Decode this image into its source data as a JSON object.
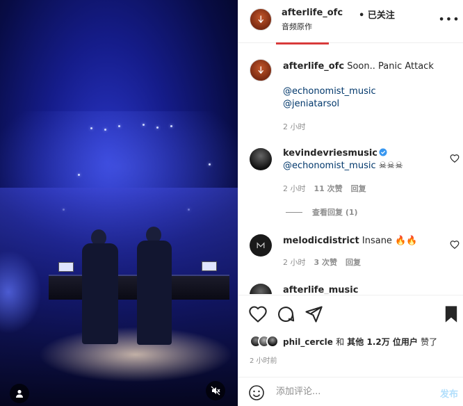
{
  "header": {
    "username": "afterlife_ofc",
    "follow_status": "• 已关注",
    "subtitle": "音频原作",
    "more_icon": "more-horizontal-icon"
  },
  "comments": [
    {
      "user": "afterlife_ofc",
      "text": "Soon.. Panic Attack",
      "mentions": [
        "@echonomist_music",
        "@jeniatarsol"
      ],
      "time": "2 小时"
    },
    {
      "user": "kevindevriesmusic",
      "verified": true,
      "mention": "@echonomist_music",
      "emoji": "☠☠☠",
      "time": "2 小时",
      "likes": "11 次赞",
      "reply": "回复"
    },
    {
      "view_replies": "查看回复 (1)"
    },
    {
      "user": "melodicdistrict",
      "text": "Insane",
      "emoji": "🔥🔥",
      "time": "2 小时",
      "likes": "3 次赞",
      "reply": "回复"
    },
    {
      "user": "afterlife_music",
      "text": "",
      "partial": true
    }
  ],
  "likes": {
    "user": "phil_cercle",
    "and": "和",
    "others": "其他 1.2万 位用户",
    "suffix": "赞了"
  },
  "time_ago": "2 小时前",
  "comment_box": {
    "placeholder": "添加评论...",
    "post": "发布"
  },
  "colors": {
    "accent": "#d83a3a",
    "link": "#00376b",
    "muted": "#8e8e8e",
    "post_disabled": "#b2dffc",
    "verified": "#3897f0"
  }
}
